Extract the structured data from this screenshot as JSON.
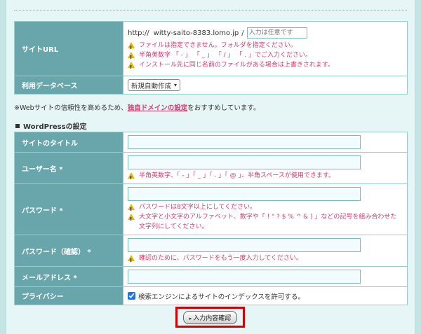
{
  "site": {
    "url_label": "サイトURL",
    "url_prefix": "http://",
    "url_domain": "witty-saito-8383.lomo.jp",
    "url_slash": "/",
    "url_placeholder": "入力は任意です",
    "url_warnings": [
      "ファイルは指定できません。フォルダを指定ください。",
      "半角英数字 「 - 」 「 _ 」 「 / 」 「 . 」でご入力ください。",
      "インストール先に同じ名前のファイルがある場合は上書きされます。"
    ],
    "db_label": "利用データベース",
    "db_selected": "新規自動作成"
  },
  "note": {
    "prefix": "※Webサイトの信頼性を高めるため、",
    "link": "独自ドメインの設定",
    "suffix": "をおすすめしています。"
  },
  "wordpress": {
    "section_title": "WordPressの設定",
    "title_label": "サイトのタイトル",
    "user_label": "ユーザー名 *",
    "user_warning": "半角英数字、「 - 」「 _ 」「 . 」「 @ 」、半角スペースが使用できます。",
    "pass_label": "パスワード *",
    "pass_warnings": [
      "パスワードは8文字以上にしてください。",
      "大文字と小文字のアルファベット、数字や「 ! \" ? $ % ^ & ) 」などの記号を組み合わせた文字列にしてください。"
    ],
    "pass_confirm_label": "パスワード（確認） *",
    "pass_confirm_warning": "確認のために、パスワードをもう一度入力してください。",
    "email_label": "メールアドレス *",
    "privacy_label": "プライバシー",
    "privacy_text": "検索エンジンによるサイトのインデックスを許可する。",
    "privacy_checked": true
  },
  "submit": {
    "label": "入力内容確認"
  }
}
